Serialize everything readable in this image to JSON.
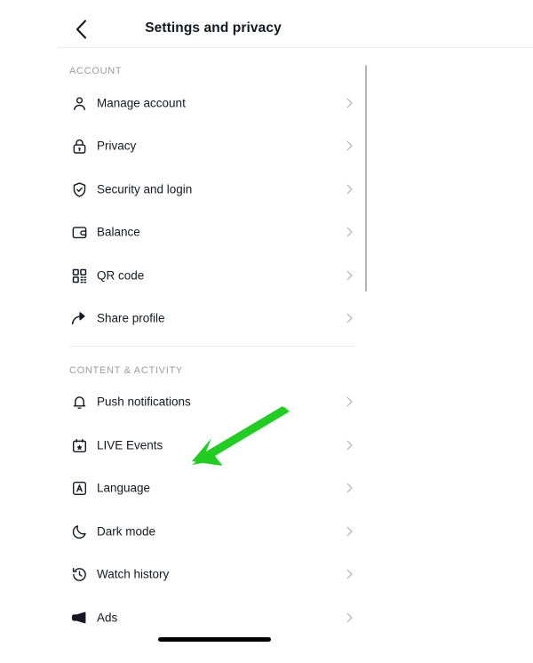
{
  "header": {
    "title": "Settings and privacy",
    "back_icon": "chevron-left-icon"
  },
  "sections": [
    {
      "id": "account",
      "label": "ACCOUNT",
      "items": [
        {
          "label": "Manage account",
          "icon": "person-icon"
        },
        {
          "label": "Privacy",
          "icon": "lock-icon"
        },
        {
          "label": "Security and login",
          "icon": "shield-check-icon"
        },
        {
          "label": "Balance",
          "icon": "wallet-icon"
        },
        {
          "label": "QR code",
          "icon": "qr-code-icon"
        },
        {
          "label": "Share profile",
          "icon": "share-arrow-icon"
        }
      ]
    },
    {
      "id": "content-activity",
      "label": "CONTENT & ACTIVITY",
      "items": [
        {
          "label": "Push notifications",
          "icon": "bell-icon"
        },
        {
          "label": "LIVE Events",
          "icon": "calendar-star-icon"
        },
        {
          "label": "Language",
          "icon": "language-a-icon"
        },
        {
          "label": "Dark mode",
          "icon": "moon-icon"
        },
        {
          "label": "Watch history",
          "icon": "clock-rewind-icon"
        },
        {
          "label": "Ads",
          "icon": "megaphone-icon"
        }
      ]
    }
  ],
  "annotation": {
    "type": "arrow",
    "color": "#22cc22",
    "points_to": "Language"
  },
  "colors": {
    "text_primary": "#161823",
    "text_muted": "#9b9ba3",
    "chevron": "#b8b8be",
    "divider": "#efefef",
    "background": "#ffffff",
    "annotation_green": "#22cc22"
  },
  "home_indicator": {
    "visible": true
  }
}
